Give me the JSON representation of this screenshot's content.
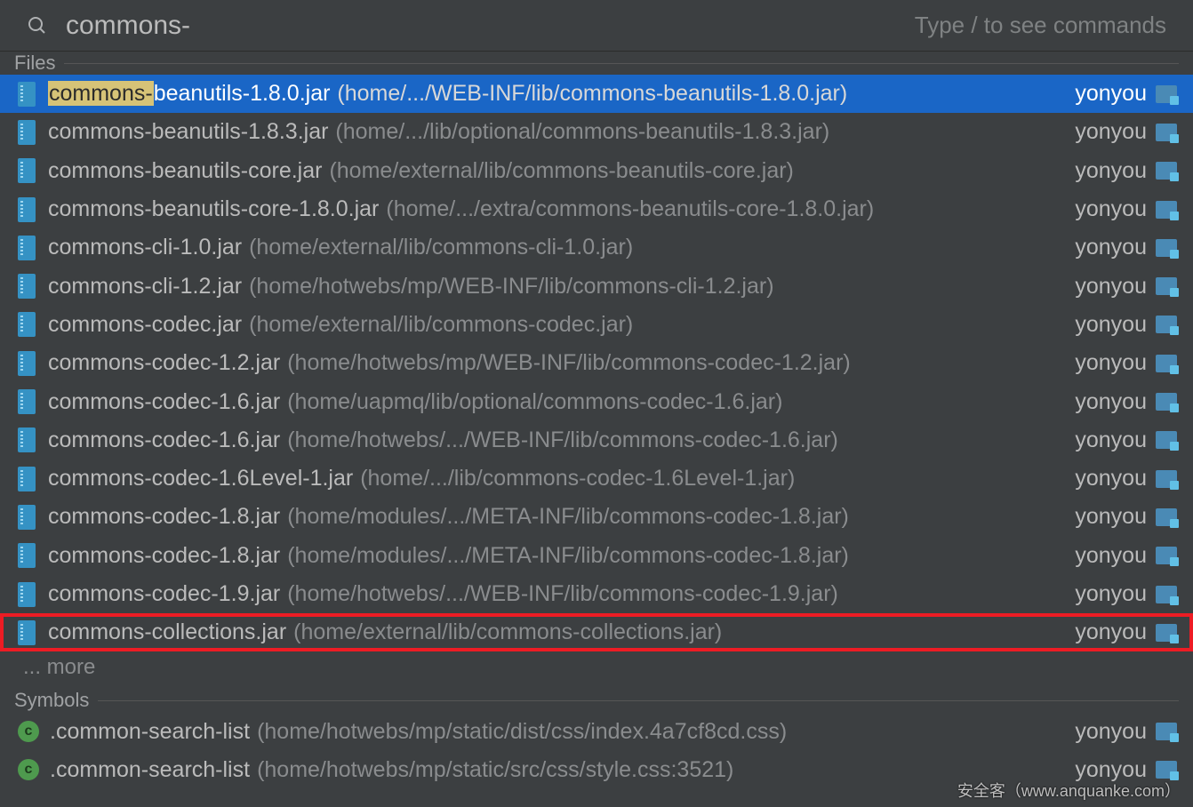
{
  "search": {
    "query": "commons-",
    "hint": "Type / to see commands",
    "match_prefix": "commons-"
  },
  "sections": {
    "files_label": "Files",
    "symbols_label": "Symbols"
  },
  "files": [
    {
      "name_rest": "beanutils-1.8.0.jar",
      "path": "(home/.../WEB-INF/lib/commons-beanutils-1.8.0.jar)",
      "module": "yonyou",
      "selected": true
    },
    {
      "name_rest": "beanutils-1.8.3.jar",
      "path": "(home/.../lib/optional/commons-beanutils-1.8.3.jar)",
      "module": "yonyou"
    },
    {
      "name_rest": "beanutils-core.jar",
      "path": "(home/external/lib/commons-beanutils-core.jar)",
      "module": "yonyou"
    },
    {
      "name_rest": "beanutils-core-1.8.0.jar",
      "path": "(home/.../extra/commons-beanutils-core-1.8.0.jar)",
      "module": "yonyou"
    },
    {
      "name_rest": "cli-1.0.jar",
      "path": "(home/external/lib/commons-cli-1.0.jar)",
      "module": "yonyou"
    },
    {
      "name_rest": "cli-1.2.jar",
      "path": "(home/hotwebs/mp/WEB-INF/lib/commons-cli-1.2.jar)",
      "module": "yonyou"
    },
    {
      "name_rest": "codec.jar",
      "path": "(home/external/lib/commons-codec.jar)",
      "module": "yonyou"
    },
    {
      "name_rest": "codec-1.2.jar",
      "path": "(home/hotwebs/mp/WEB-INF/lib/commons-codec-1.2.jar)",
      "module": "yonyou"
    },
    {
      "name_rest": "codec-1.6.jar",
      "path": "(home/uapmq/lib/optional/commons-codec-1.6.jar)",
      "module": "yonyou"
    },
    {
      "name_rest": "codec-1.6.jar",
      "path": "(home/hotwebs/.../WEB-INF/lib/commons-codec-1.6.jar)",
      "module": "yonyou"
    },
    {
      "name_rest": "codec-1.6Level-1.jar",
      "path": "(home/.../lib/commons-codec-1.6Level-1.jar)",
      "module": "yonyou"
    },
    {
      "name_rest": "codec-1.8.jar",
      "path": "(home/modules/.../META-INF/lib/commons-codec-1.8.jar)",
      "module": "yonyou"
    },
    {
      "name_rest": "codec-1.8.jar",
      "path": "(home/modules/.../META-INF/lib/commons-codec-1.8.jar)",
      "module": "yonyou"
    },
    {
      "name_rest": "codec-1.9.jar",
      "path": "(home/hotwebs/.../WEB-INF/lib/commons-codec-1.9.jar)",
      "module": "yonyou"
    },
    {
      "name_rest": "collections.jar",
      "path": "(home/external/lib/commons-collections.jar)",
      "module": "yonyou",
      "boxed": true
    }
  ],
  "more_label": "... more",
  "symbols": [
    {
      "letter": "c",
      "name": ".common-search-list",
      "path": "(home/hotwebs/mp/static/dist/css/index.4a7cf8cd.css)",
      "module": "yonyou"
    },
    {
      "letter": "c",
      "name": ".common-search-list",
      "path": "(home/hotwebs/mp/static/src/css/style.css:3521)",
      "module": "yonyou"
    }
  ],
  "watermark": "安全客（www.anquanke.com）"
}
